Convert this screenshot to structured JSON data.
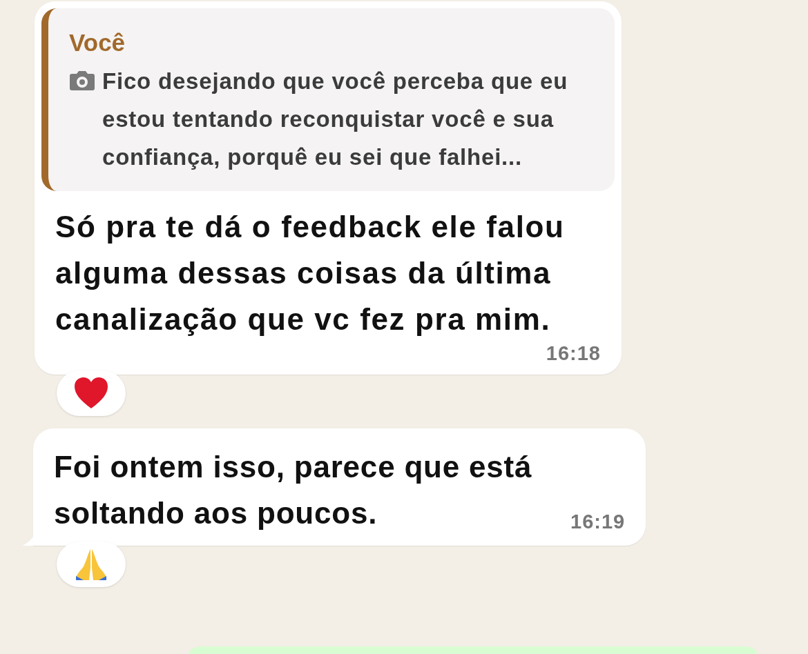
{
  "messages": [
    {
      "quote": {
        "author": "Você",
        "text": "Fico desejando que você perceba que eu estou tentando reconquistar você e sua confiança, porquê eu sei que falhei..."
      },
      "text": "Só pra te dá o feedback ele falou alguma dessas coisas da última canalização que vc fez pra mim.",
      "time": "16:18",
      "tail": false,
      "reaction": {
        "kind": "heart"
      }
    },
    {
      "text": "Foi ontem isso, parece que está soltando aos poucos.",
      "time": "16:19",
      "tail": true,
      "reaction": {
        "kind": "pray"
      }
    }
  ]
}
